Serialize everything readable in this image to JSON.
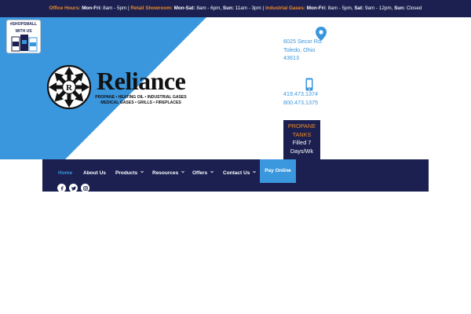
{
  "topbar": {
    "office_label": "Office Hours:",
    "office_days": "Mon-Fri:",
    "office_hours": " 8am - 5pm | ",
    "retail_label": "Retail Showroom:",
    "retail_days": " Mon-Sat:",
    "retail_hours": " 8am - 6pm, ",
    "retail_sun": "Sun:",
    "retail_sun_hours": " 11am - 3pm | ",
    "industrial_label": "Industrial Gases:",
    "industrial_days": " Mon-Fri:",
    "industrial_hours": " 8am - 5pm, ",
    "industrial_sat": "Sat:",
    "industrial_sat_hours": " 9am - 12pm, ",
    "industrial_sun": "Sun:",
    "industrial_sun_hours": " Closed"
  },
  "badge": {
    "line1": "#SHOPSMALL",
    "line2": "WITH US"
  },
  "brand": {
    "name": "Reliance",
    "emblem_letter": "R",
    "tagline1": "PROPANE • HEATING OIL • INDUSTRIAL GASES",
    "tagline2": "MEDICAL GASES • GRILLS • FIREPLACES"
  },
  "address": {
    "line1": "6025 Secor Rd.",
    "line2": "Toledo, Ohio",
    "line3": "43613"
  },
  "phones": {
    "line1": "419.473.1374",
    "line2": "800.473.1375"
  },
  "propane_box": {
    "line1": "PROPANE",
    "line2": "TANKS",
    "line3": "Filled 7",
    "line4": "Days/Wk"
  },
  "nav": {
    "items": [
      {
        "label": "Home"
      },
      {
        "label": "About Us"
      },
      {
        "label": "Products"
      },
      {
        "label": "Resources"
      },
      {
        "label": "Offers"
      },
      {
        "label": "Contact Us"
      }
    ],
    "pay_label": "Pay Online"
  },
  "social": [
    "facebook-icon",
    "twitter-icon",
    "instagram-icon"
  ],
  "colors": {
    "navy": "#1b2050",
    "blue": "#3a96dd",
    "orange": "#f08a24"
  }
}
